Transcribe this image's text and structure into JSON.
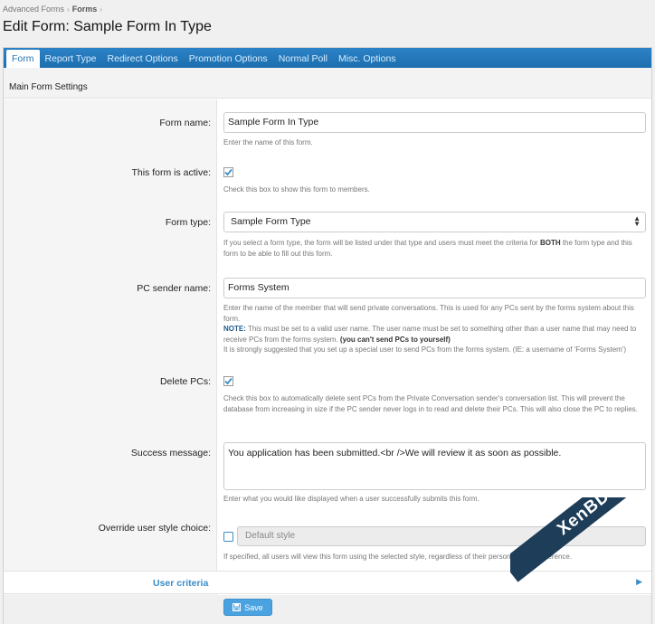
{
  "breadcrumb": {
    "items": [
      "Advanced Forms",
      "Forms"
    ]
  },
  "page": {
    "title": "Edit Form: Sample Form In Type"
  },
  "tabs": [
    {
      "label": "Form",
      "active": true
    },
    {
      "label": "Report Type"
    },
    {
      "label": "Redirect Options"
    },
    {
      "label": "Promotion Options"
    },
    {
      "label": "Normal Poll"
    },
    {
      "label": "Misc. Options"
    }
  ],
  "section": {
    "title": "Main Form Settings"
  },
  "fields": {
    "form_name": {
      "label": "Form name:",
      "value": "Sample Form In Type",
      "hint": "Enter the name of this form."
    },
    "active": {
      "label": "This form is active:",
      "checked": true,
      "hint": "Check this box to show this form to members."
    },
    "form_type": {
      "label": "Form type:",
      "value": "Sample Form Type",
      "hint_pre": "If you select a form type, the form will be listed under that type and users must meet the criteria for ",
      "hint_bold": "BOTH",
      "hint_post": " the form type and this form to be able to fill out this form."
    },
    "pc_sender": {
      "label": "PC sender name:",
      "value": "Forms System",
      "hint_line1": "Enter the name of the member that will send private conversations. This is used for any PCs sent by the forms system about this form.",
      "note_label": "NOTE:",
      "note_text": " This must be set to a valid user name. The user name must be set to something other than a user name that may need to receive PCs from the forms system. ",
      "note_bold": "(you can't send PCs to yourself)",
      "hint_line3": "It is strongly suggested that you set up a special user to send PCs from the forms system. (IE: a username of 'Forms System')"
    },
    "delete_pcs": {
      "label": "Delete PCs:",
      "checked": true,
      "hint": "Check this box to automatically delete sent PCs from the Private Conversation sender's conversation list. This will prevent the database from increasing in size if the PC sender never logs in to read and delete their PCs. This will also close the PC to replies."
    },
    "success_message": {
      "label": "Success message:",
      "value": "You application has been submitted.<br />We will review it as soon as possible.",
      "hint": "Enter what you would like displayed when a user successfully submits this form."
    },
    "override_style": {
      "label": "Override user style choice:",
      "checked": false,
      "select_value": "Default style",
      "hint": "If specified, all users will view this form using the selected style, regardless of their personal style preference."
    }
  },
  "user_criteria": {
    "label": "User criteria"
  },
  "footer": {
    "save_label": "Save"
  },
  "watermark": {
    "text": "XenBD.Com"
  },
  "colors": {
    "accent": "#2b82c6",
    "link": "#3a8dc9",
    "button": "#4aa3e0"
  }
}
